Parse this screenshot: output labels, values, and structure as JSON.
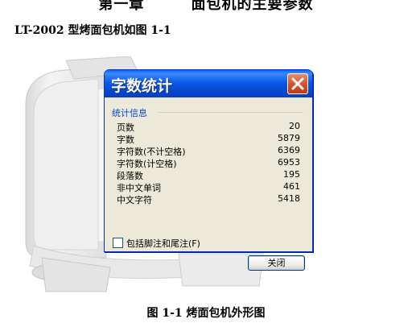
{
  "document": {
    "heading": "第一章        面包机的主要参数",
    "subtitle": "LT-2002 型烤面包机如图 1-1",
    "caption": "图 1-1 烤面包机外形图"
  },
  "dialog": {
    "title": "字数统计",
    "group_title": "统计信息",
    "stats": [
      {
        "label": "页数",
        "value": "20"
      },
      {
        "label": "字数",
        "value": "5879"
      },
      {
        "label": "字符数(不计空格)",
        "value": "6369"
      },
      {
        "label": "字符数(计空格)",
        "value": "6953"
      },
      {
        "label": "段落数",
        "value": "195"
      },
      {
        "label": "非中文单词",
        "value": "461"
      },
      {
        "label": "中文字符",
        "value": "5418"
      }
    ],
    "checkbox_label": "包括脚注和尾注(F)",
    "close_button_label": "关闭"
  }
}
